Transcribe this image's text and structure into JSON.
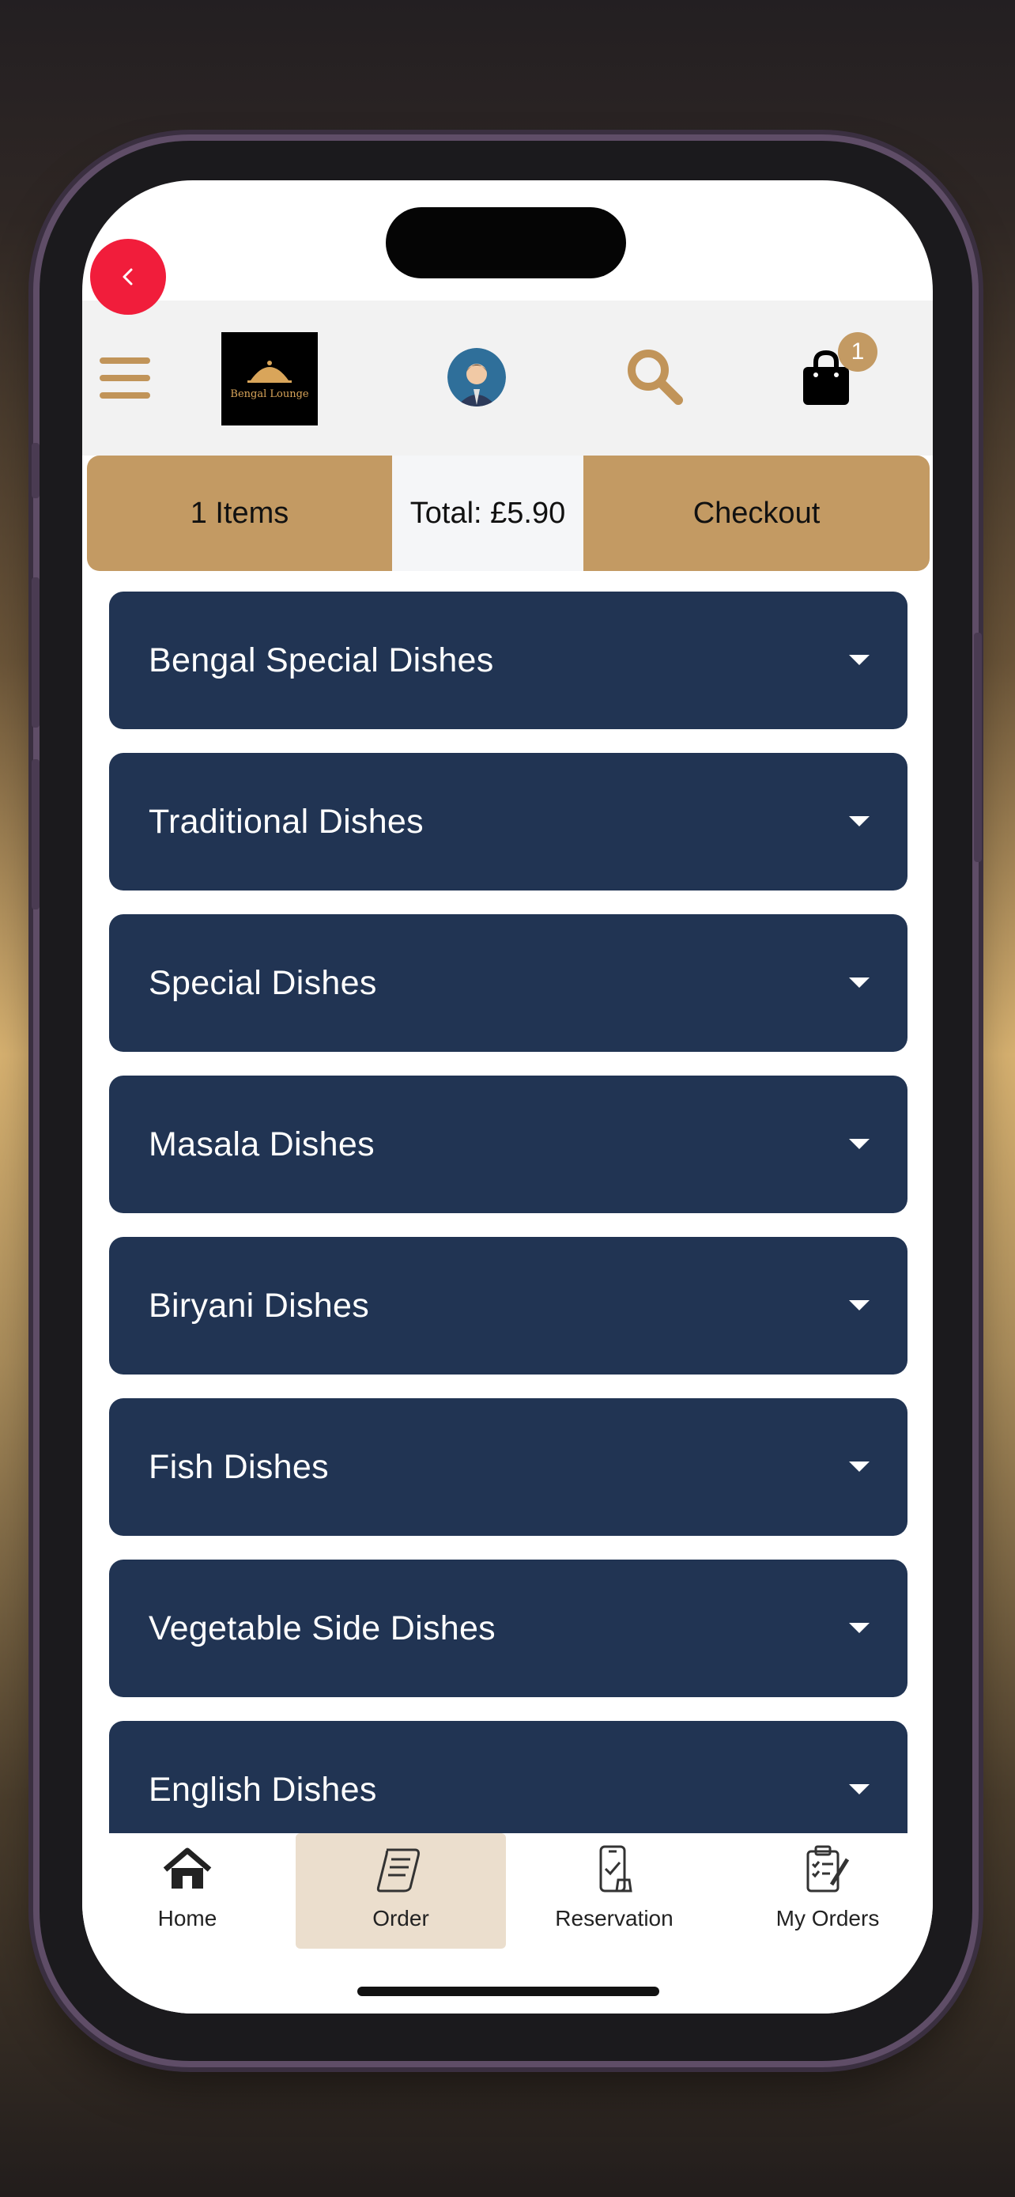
{
  "header": {
    "logo_text": "Bengal Lounge",
    "cart_count": "1"
  },
  "summary": {
    "items_label": "1 Items",
    "total_label": "Total: £5.90",
    "checkout_label": "Checkout"
  },
  "categories": [
    {
      "label": "Bengal Special Dishes"
    },
    {
      "label": "Traditional Dishes"
    },
    {
      "label": "Special Dishes"
    },
    {
      "label": "Masala Dishes"
    },
    {
      "label": "Biryani Dishes"
    },
    {
      "label": "Fish Dishes"
    },
    {
      "label": "Vegetable Side Dishes"
    },
    {
      "label": "English Dishes"
    }
  ],
  "nav": [
    {
      "label": "Home",
      "icon": "home-icon"
    },
    {
      "label": "Order",
      "icon": "order-scroll-icon",
      "active": true
    },
    {
      "label": "Reservation",
      "icon": "reservation-phone-icon"
    },
    {
      "label": "My Orders",
      "icon": "my-orders-clipboard-icon"
    }
  ],
  "colors": {
    "accent": "#c39a63",
    "category_bg": "#213453",
    "back_button": "#f11d3b",
    "active_nav_bg": "#ebdecd"
  }
}
